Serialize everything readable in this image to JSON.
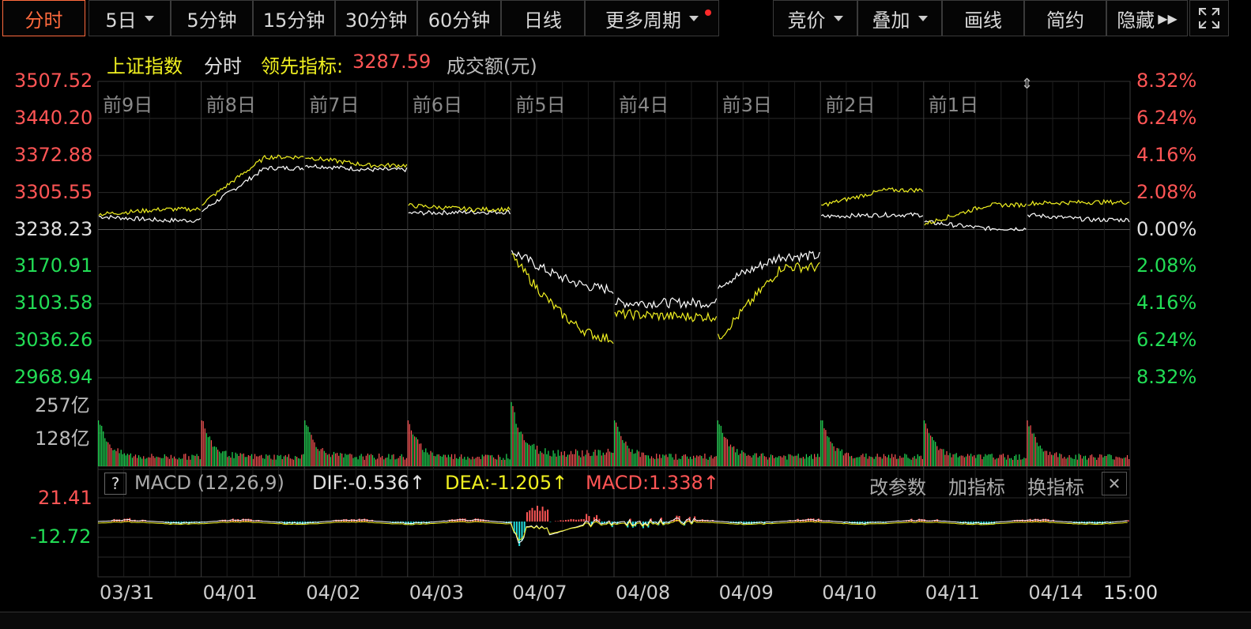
{
  "toolbar": {
    "tabs": [
      "分时",
      "5日",
      "5分钟",
      "15分钟",
      "30分钟",
      "60分钟",
      "日线",
      "更多周期"
    ],
    "active_tab": "分时",
    "right_buttons": [
      "竞价",
      "叠加",
      "画线",
      "简约",
      "隐藏"
    ]
  },
  "header": {
    "index_name": "上证指数",
    "mode": "分时",
    "leading_label": "领先指标:",
    "leading_value": "3287.59",
    "volume_label": "成交额(元)"
  },
  "chart": {
    "left_ticks": [
      "3507.52",
      "3440.20",
      "3372.88",
      "3305.55",
      "3238.23",
      "3170.91",
      "3103.58",
      "3036.26",
      "2968.94"
    ],
    "right_ticks": [
      "8.32%",
      "6.24%",
      "4.16%",
      "2.08%",
      "0.00%",
      "2.08%",
      "4.16%",
      "6.24%",
      "8.32%"
    ],
    "day_labels": [
      "前9日",
      "前8日",
      "前7日",
      "前6日",
      "前5日",
      "前4日",
      "前3日",
      "前2日",
      "前1日"
    ],
    "volume_ticks": [
      "257亿",
      "128亿"
    ],
    "date_labels": [
      "03/31",
      "04/01",
      "04/02",
      "04/03",
      "04/07",
      "04/08",
      "04/09",
      "04/10",
      "04/11",
      "04/14"
    ],
    "end_time": "15:00"
  },
  "macd": {
    "help": "?",
    "name": "MACD (12,26,9)",
    "dif": "DIF:-0.536↑",
    "dea": "DEA:-1.205↑",
    "macd": "MACD:1.338↑",
    "buttons": [
      "改参数",
      "加指标",
      "换指标"
    ],
    "ticks": [
      "21.41",
      "-12.72"
    ]
  },
  "chart_data": {
    "type": "line",
    "title": "上证指数",
    "x": [
      "03/31",
      "04/01",
      "04/02",
      "04/03",
      "04/07",
      "04/08",
      "04/09",
      "04/10",
      "04/11",
      "04/14"
    ],
    "ylim": [
      2968.94,
      3507.52
    ],
    "series": [
      {
        "values": [
          3255,
          3350,
          3347,
          3270,
          3130,
          3105,
          3190,
          3265,
          3240,
          3256
        ]
      },
      {
        "values": [
          3275,
          3370,
          3355,
          3275,
          3040,
          3080,
          3170,
          3310,
          3283,
          3288
        ]
      }
    ]
  }
}
